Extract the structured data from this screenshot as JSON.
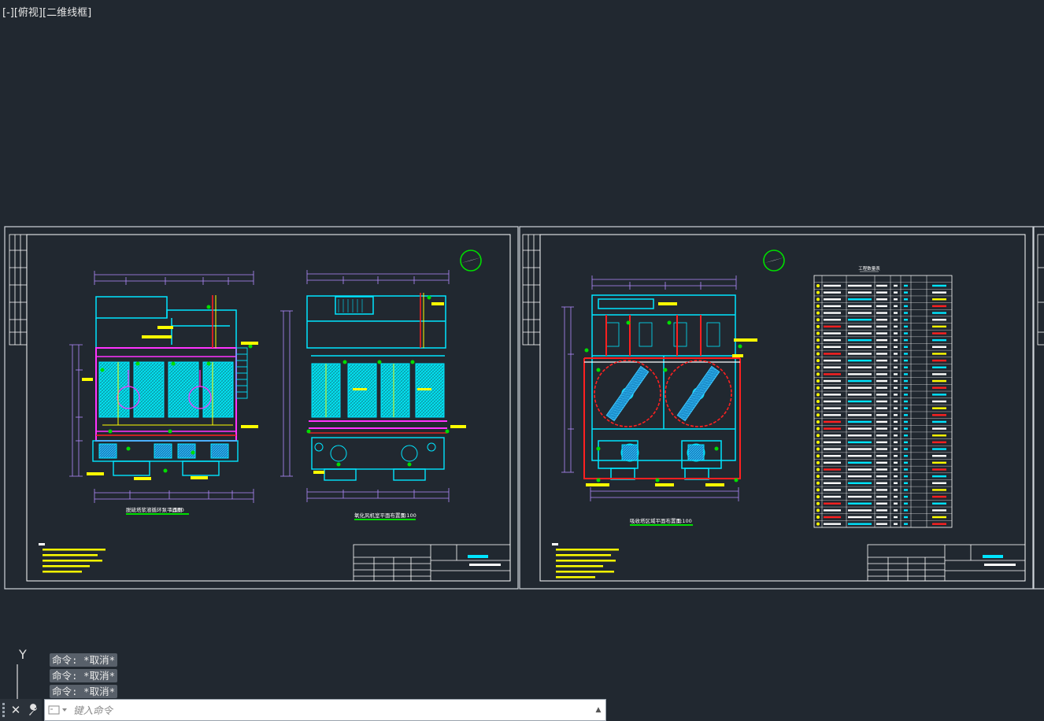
{
  "viewport": {
    "controls": "[-]",
    "view": "[俯视]",
    "style": "[二维线框]"
  },
  "drawings": [
    {
      "plans": [
        {
          "title": "脱硫塔浆液循环泵平面图",
          "scale": "1:100"
        },
        {
          "title": "氧化风机室平面布置图",
          "scale": "1:100"
        }
      ]
    },
    {
      "plans": [
        {
          "title": "吸收塔区域平面布置图",
          "scale": "1:100"
        }
      ],
      "table_title": "工程数量表"
    }
  ],
  "ucs": {
    "axis": "Y"
  },
  "command_history": [
    "命令: *取消*",
    "命令: *取消*",
    "命令: *取消*"
  ],
  "command_line": {
    "placeholder": "键入命令",
    "value": ""
  },
  "colors": {
    "background": "#212830",
    "cyan": "#00e5ff",
    "yellow": "#ffff00",
    "magenta": "#ff33ff",
    "red": "#ff2020",
    "green": "#00dd00",
    "white": "#ffffff"
  }
}
